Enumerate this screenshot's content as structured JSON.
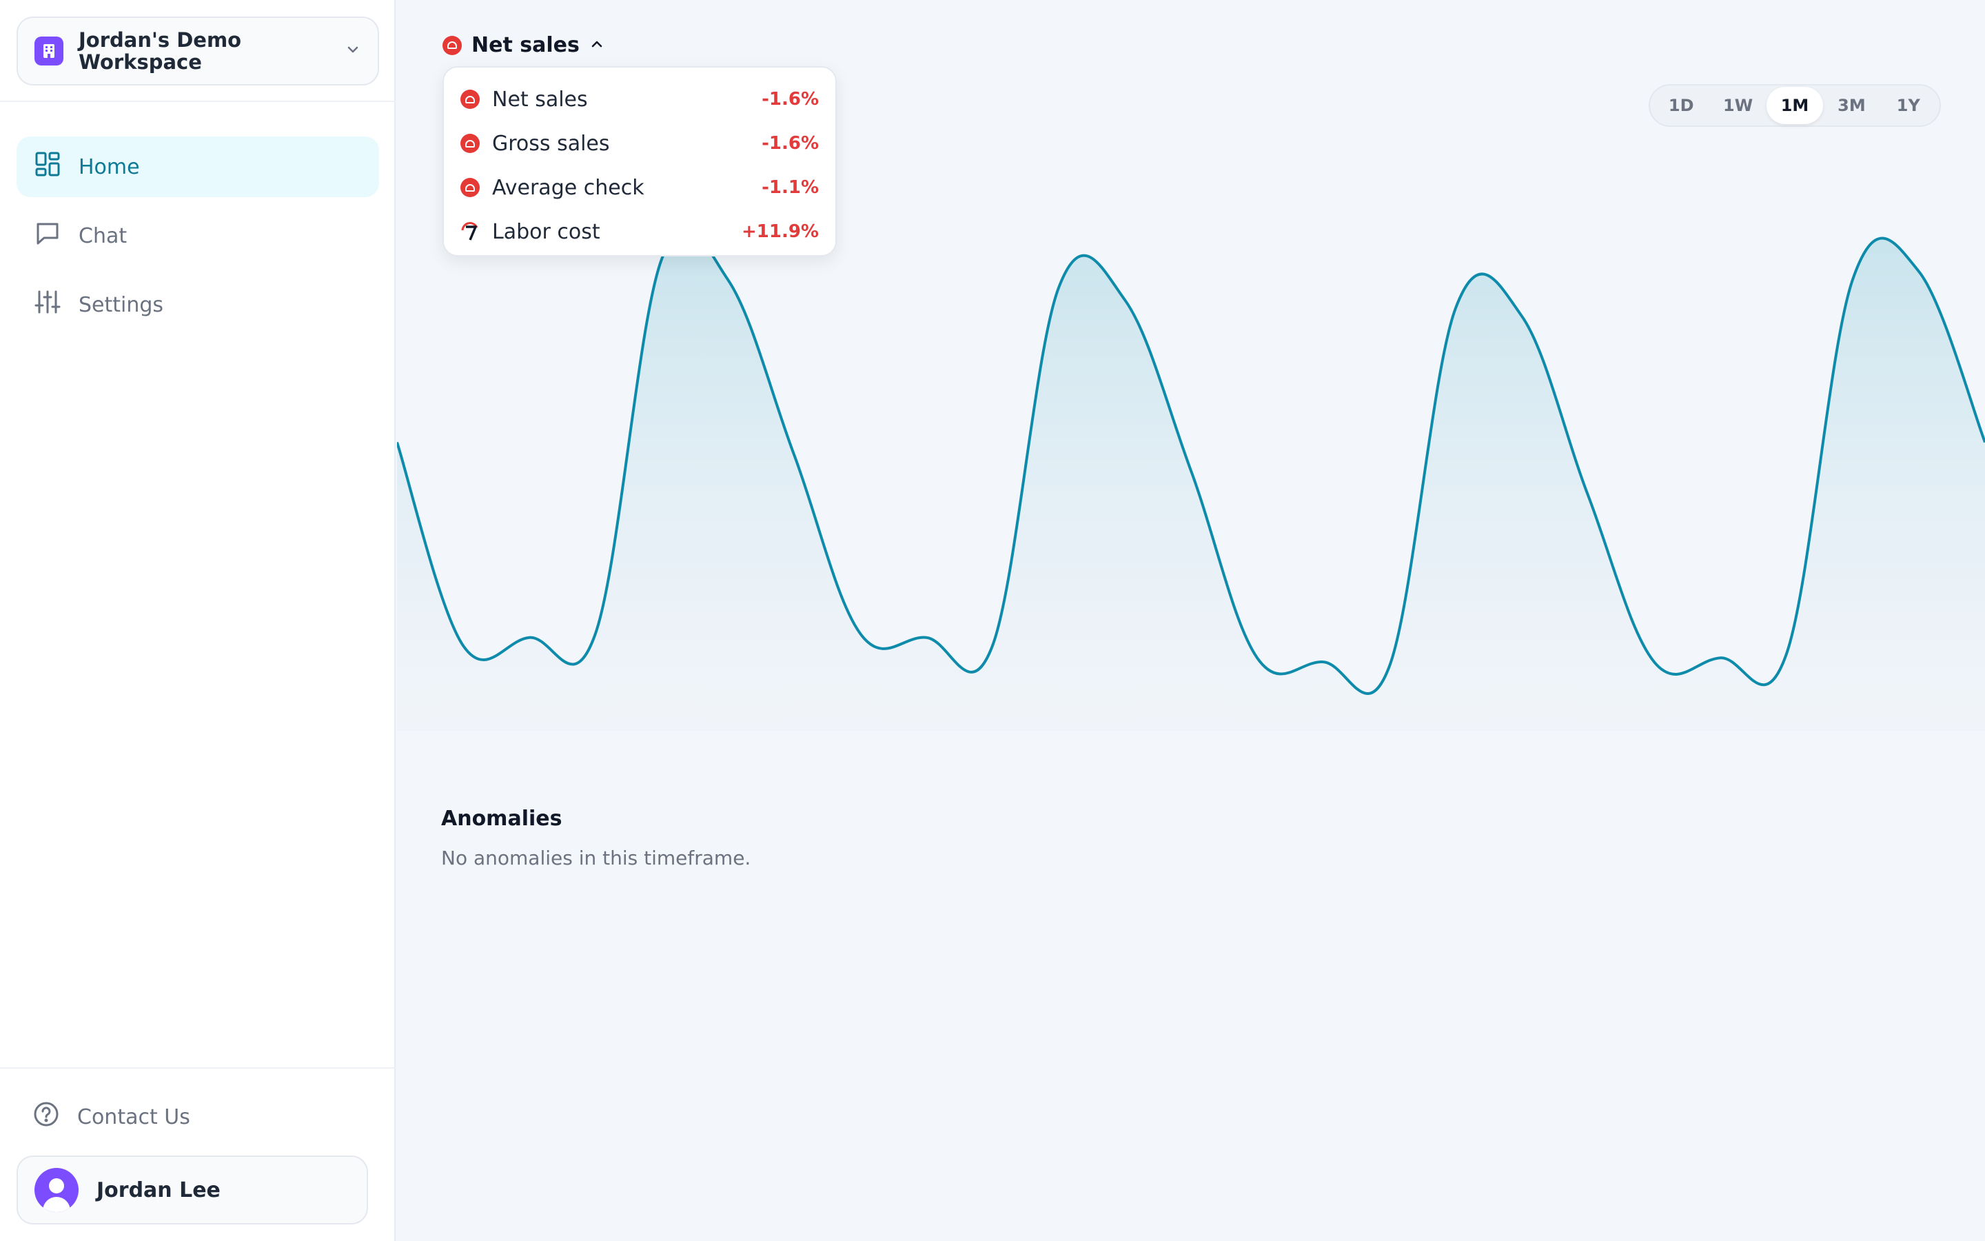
{
  "workspace": {
    "name": "Jordan's Demo Workspace"
  },
  "nav": {
    "items": [
      {
        "label": "Home",
        "icon": "dashboard-icon",
        "active": true
      },
      {
        "label": "Chat",
        "icon": "chat-icon",
        "active": false
      },
      {
        "label": "Settings",
        "icon": "sliders-icon",
        "active": false
      }
    ]
  },
  "footer": {
    "contact_label": "Contact Us",
    "user_name": "Jordan Lee"
  },
  "metric": {
    "selected": "Net sales",
    "options": [
      {
        "label": "Net sales",
        "delta": "-1.6%",
        "icon": "red-brand-icon"
      },
      {
        "label": "Gross sales",
        "delta": "-1.6%",
        "icon": "red-brand-icon"
      },
      {
        "label": "Average check",
        "delta": "-1.1%",
        "icon": "red-brand-icon"
      },
      {
        "label": "Labor cost",
        "delta": "+11.9%",
        "icon": "seven-brand-icon"
      }
    ]
  },
  "range": {
    "options": [
      "1D",
      "1W",
      "1M",
      "3M",
      "1Y"
    ],
    "selected": "1M"
  },
  "anomalies": {
    "title": "Anomalies",
    "empty_text": "No anomalies in this timeframe."
  },
  "colors": {
    "accent": "#0e8bab",
    "active_nav_bg": "#e8fafd",
    "negative": "#e23b3b",
    "brand_purple": "#7c4dff"
  },
  "chart_data": {
    "type": "area",
    "values": [
      0.55,
      0.05,
      0.07,
      0.08,
      1.0,
      0.95,
      0.52,
      0.08,
      0.07,
      0.05,
      0.93,
      0.9,
      0.48,
      0.02,
      0.01,
      0.0,
      0.88,
      0.86,
      0.42,
      0.01,
      0.02,
      0.03,
      0.95,
      0.97,
      0.55
    ]
  }
}
